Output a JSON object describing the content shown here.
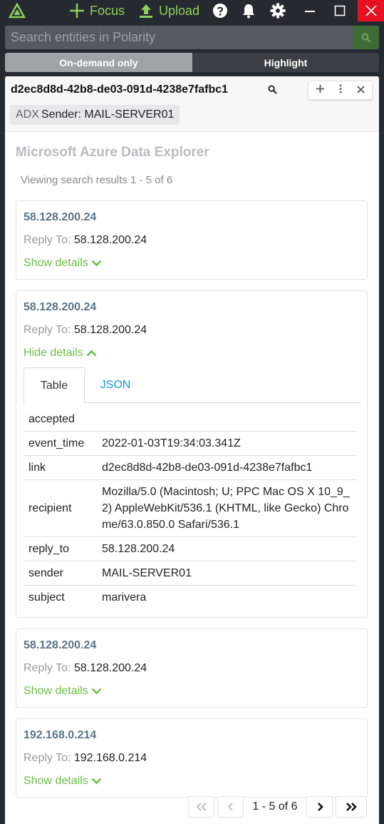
{
  "titlebar": {
    "focus_label": "Focus",
    "upload_label": "Upload"
  },
  "search": {
    "placeholder": "Search entities in Polarity"
  },
  "toggle": {
    "on_demand_label": "On-demand only",
    "highlight_label": "Highlight"
  },
  "entity": {
    "value": "d2ec8d8d-42b8-de03-091d-4238e7fafbc1",
    "tag_type": "ADX",
    "tag_label": "Sender: MAIL-SERVER01"
  },
  "integration": {
    "name": "Microsoft Azure Data Explorer",
    "summary": "Viewing search results 1 - 5 of 6"
  },
  "results": [
    {
      "title": "58.128.200.24",
      "field_label": "Reply To:",
      "field_value": "58.128.200.24",
      "toggle_label": "Show details"
    },
    {
      "title": "58.128.200.24",
      "field_label": "Reply To:",
      "field_value": "58.128.200.24",
      "toggle_label": "Hide details"
    },
    {
      "title": "58.128.200.24",
      "field_label": "Reply To:",
      "field_value": "58.128.200.24",
      "toggle_label": "Show details"
    },
    {
      "title": "192.168.0.214",
      "field_label": "Reply To:",
      "field_value": "192.168.0.214",
      "toggle_label": "Show details"
    }
  ],
  "details": {
    "tabs": [
      "Table",
      "JSON"
    ],
    "rows": [
      {
        "key": "accepted",
        "value": ""
      },
      {
        "key": "event_time",
        "value": "2022-01-03T19:34:03.341Z"
      },
      {
        "key": "link",
        "value": "d2ec8d8d-42b8-de03-091d-4238e7fafbc1"
      },
      {
        "key": "recipient",
        "value": "Mozilla/5.0 (Macintosh; U; PPC Mac OS X 10_9_2) AppleWebKit/536.1 (KHTML, like Gecko) Chrome/63.0.850.0 Safari/536.1"
      },
      {
        "key": "reply_to",
        "value": "58.128.200.24"
      },
      {
        "key": "sender",
        "value": "MAIL-SERVER01"
      },
      {
        "key": "subject",
        "value": "marivera"
      }
    ]
  },
  "pager": {
    "label": "1 - 5 of 6"
  },
  "colors": {
    "accent_green": "#8fce5a",
    "link_green": "#6dbd47",
    "link_blue": "#1a9ad6",
    "close_red": "#e81123"
  }
}
